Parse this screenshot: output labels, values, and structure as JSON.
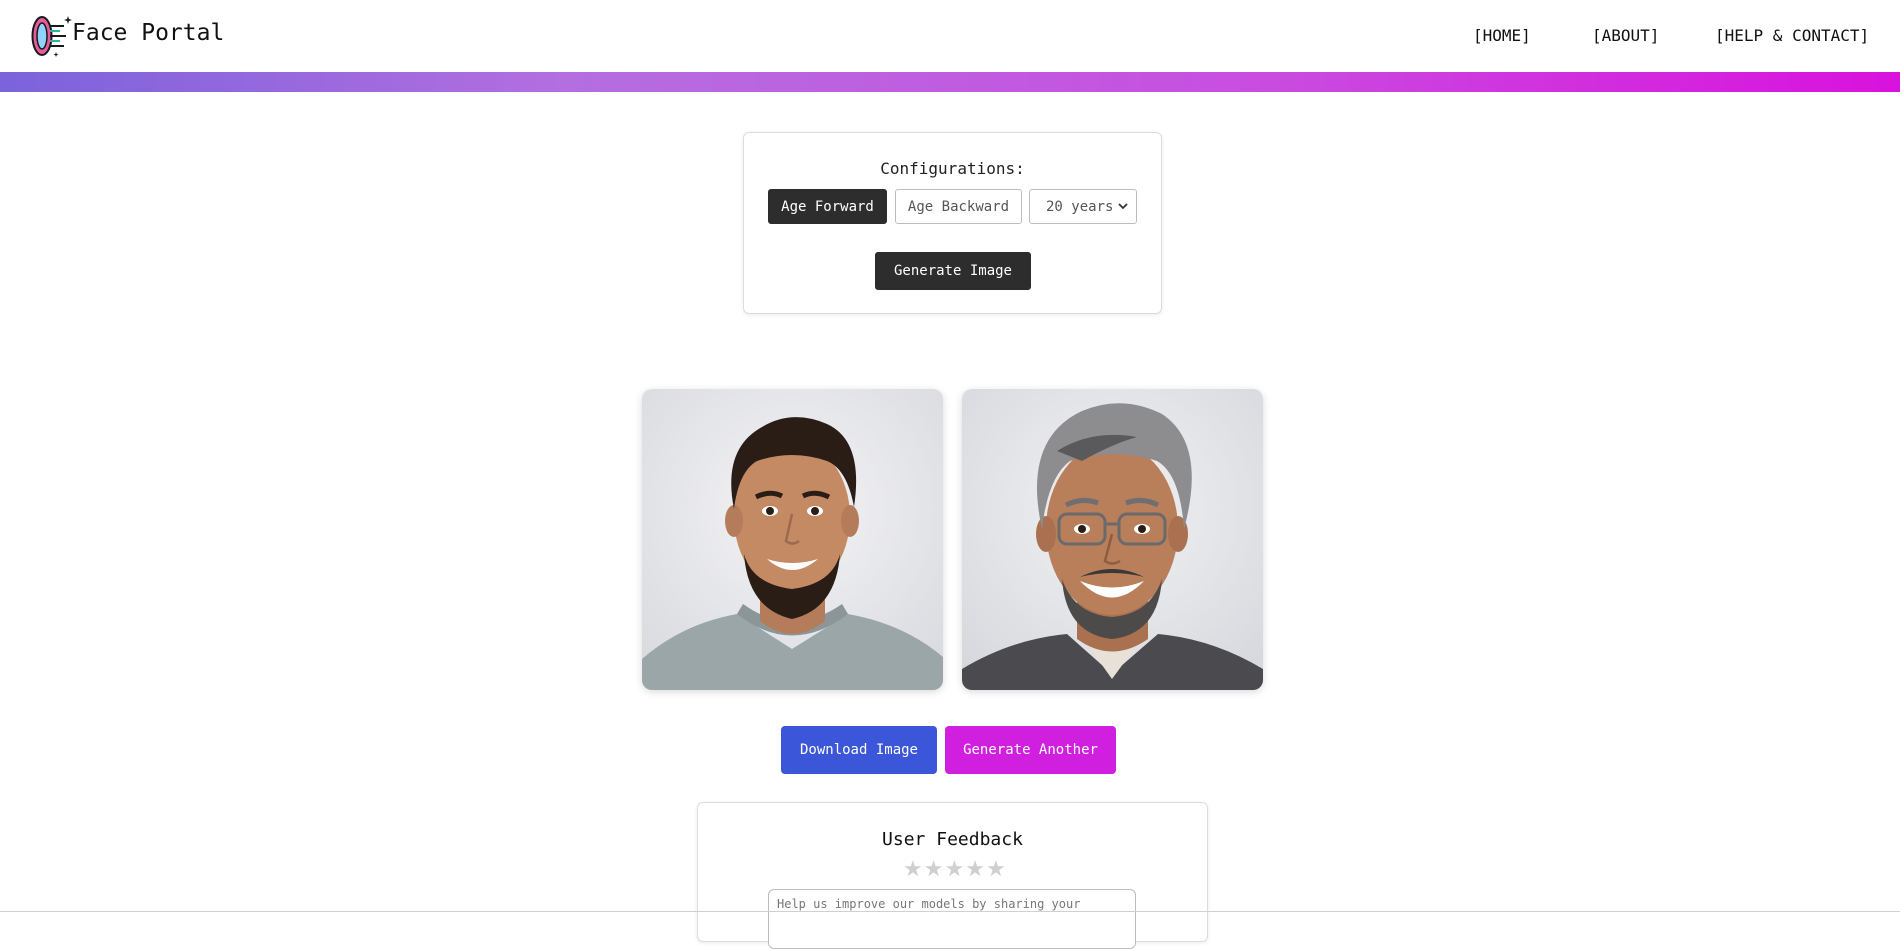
{
  "brand": {
    "name": "Face Portal",
    "logo_icon": "portal-face-icon"
  },
  "nav": {
    "items": [
      {
        "label": "[HOME]"
      },
      {
        "label": "[ABOUT]"
      },
      {
        "label": "[HELP & CONTACT]"
      }
    ]
  },
  "colors": {
    "accent_gradient": [
      "#7b63dc",
      "#b46ee0",
      "#d911dd"
    ],
    "dark_button": "#2d2d2d",
    "download_button": "#3b56d9",
    "generate_another_button": "#d11fe0"
  },
  "config": {
    "title": "Configurations:",
    "age_forward_label": "Age Forward",
    "age_backward_label": "Age Backward",
    "selected_mode": "Age Forward",
    "years_selected": "20 years",
    "generate_label": "Generate Image"
  },
  "images": {
    "original_icon": "young-man-portrait",
    "result_icon": "older-man-portrait"
  },
  "actions": {
    "download_label": "Download Image",
    "generate_another_label": "Generate Another"
  },
  "feedback": {
    "title": "User Feedback",
    "rating": 0,
    "rating_max": 5,
    "star_glyph": "★",
    "placeholder": "Help us improve our models by sharing your"
  }
}
